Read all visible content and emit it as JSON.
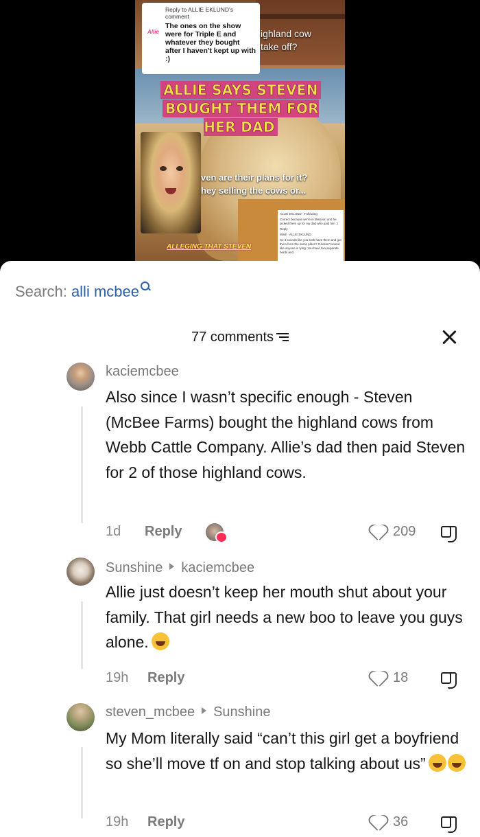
{
  "video": {
    "reply_head": "Reply to ALLIE EKLUND's comment",
    "reply_badge": "Allie",
    "reply_body": "The ones on the show were for Triple E and whatever they bought after I haven't kept up with :)",
    "caption_right_1": "ighland cow",
    "caption_right_2": "take off?",
    "title_line1": "ALLIE SAYS STEVEN",
    "title_line2": "BOUGHT THEM FOR HER DAD",
    "caption_mid_1": "ven are their plans for it?",
    "caption_mid_2": "hey selling the cows or...",
    "mini_1": "ALLIE EKLUND · Following",
    "mini_2": "Correct because we're in Missouri and he picked them up for my dad who paid him :)",
    "mini_3": "Reply",
    "mini_4": "Wait! · ALLIE EKLUND",
    "mini_5": "So it sounds like you both have them and got them from the same place? It doesn't sound like anyone is lying. You have two separate herds and",
    "alleging": "ALLEGING THAT STEVEN"
  },
  "search": {
    "label": "Search: ",
    "query": "alli mcbee",
    "icon": "search-icon"
  },
  "header": {
    "count_label": "77 comments"
  },
  "comments": [
    {
      "username": "kaciemcbee",
      "reply_to": "",
      "text": "Also since I wasn’t specific enough - Steven (McBee Farms) bought the highland cows from Webb Cattle Company. Allie’s dad then paid Steven for 2 of those highland cows.",
      "time": "1d",
      "reply_label": "Reply",
      "likes": "209"
    },
    {
      "username": "Sunshine",
      "reply_to": "kaciemcbee",
      "text": "Allie just doesn’t keep her mouth shut about your family. That girl needs a new boo to leave you guys alone.",
      "time": "19h",
      "reply_label": "Reply",
      "likes": "18"
    },
    {
      "username": "steven_mcbee",
      "reply_to": "Sunshine",
      "text": "My Mom literally said “can’t this girl get a boyfriend so she’ll move tf on and stop talking about us”",
      "time": "19h",
      "reply_label": "Reply",
      "likes": "36"
    }
  ],
  "colors": {
    "sheet_bg": "#ffffff",
    "link_blue": "#2c61a8",
    "like_red": "#fe2c55",
    "banner_pink": "#d2447d",
    "banner_yellow": "#f3e24a"
  }
}
